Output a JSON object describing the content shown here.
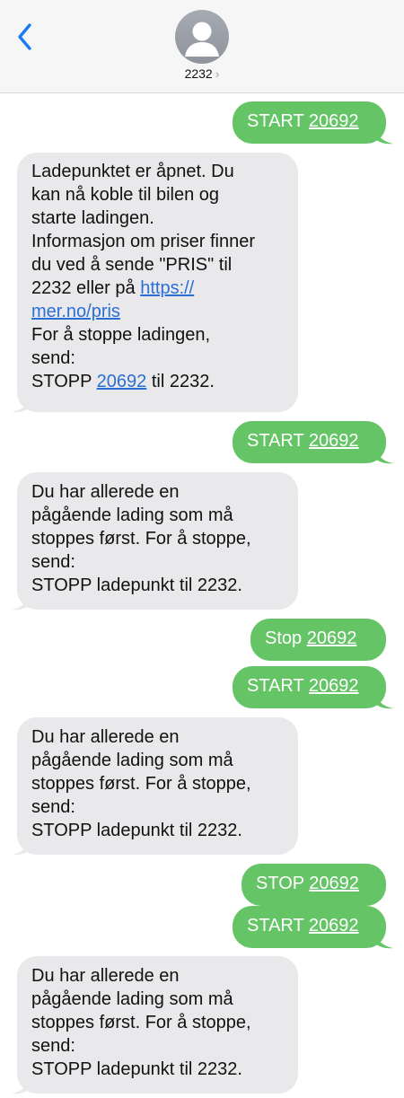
{
  "header": {
    "contact_name": "2232",
    "chevron": "›",
    "back_icon": "chevron-left-icon",
    "avatar_icon": "person-icon"
  },
  "colors": {
    "outgoing": "#65c466",
    "incoming": "#e9e9eb",
    "link": "#2a6fd6",
    "accent": "#1a7cf5"
  },
  "messages": [
    {
      "dir": "out",
      "prefix": "START ",
      "number": "20692"
    },
    {
      "dir": "in",
      "p1": "Ladepunktet er åpnet. Du\nkan nå koble til bilen og\nstarte ladingen.\nInformasjon om priser finner\ndu ved å sende \"PRIS\" til\n2232 eller på ",
      "link1": "https://\nmer.no/pris",
      "p2": "\nFor å stoppe ladingen,\nsend:\nSTOPP ",
      "link2": "20692",
      "p3": " til 2232."
    },
    {
      "dir": "out",
      "prefix": "START ",
      "number": "20692"
    },
    {
      "dir": "in",
      "text": "Du har allerede en\npågående lading som må\nstoppes først. For å stoppe,\nsend:\nSTOPP ladepunkt til 2232."
    },
    {
      "dir": "out",
      "prefix": "Stop ",
      "number": "20692"
    },
    {
      "dir": "out",
      "prefix": "START ",
      "number": "20692"
    },
    {
      "dir": "in",
      "text": "Du har allerede en\npågående lading som må\nstoppes først. For å stoppe,\nsend:\nSTOPP ladepunkt til 2232."
    },
    {
      "dir": "out",
      "prefix": "STOP ",
      "number": "20692"
    },
    {
      "dir": "out",
      "prefix": "START ",
      "number": "20692"
    },
    {
      "dir": "in",
      "text": "Du har allerede en\npågående lading som må\nstoppes først. For å stoppe,\nsend:\nSTOPP ladepunkt til 2232."
    }
  ]
}
